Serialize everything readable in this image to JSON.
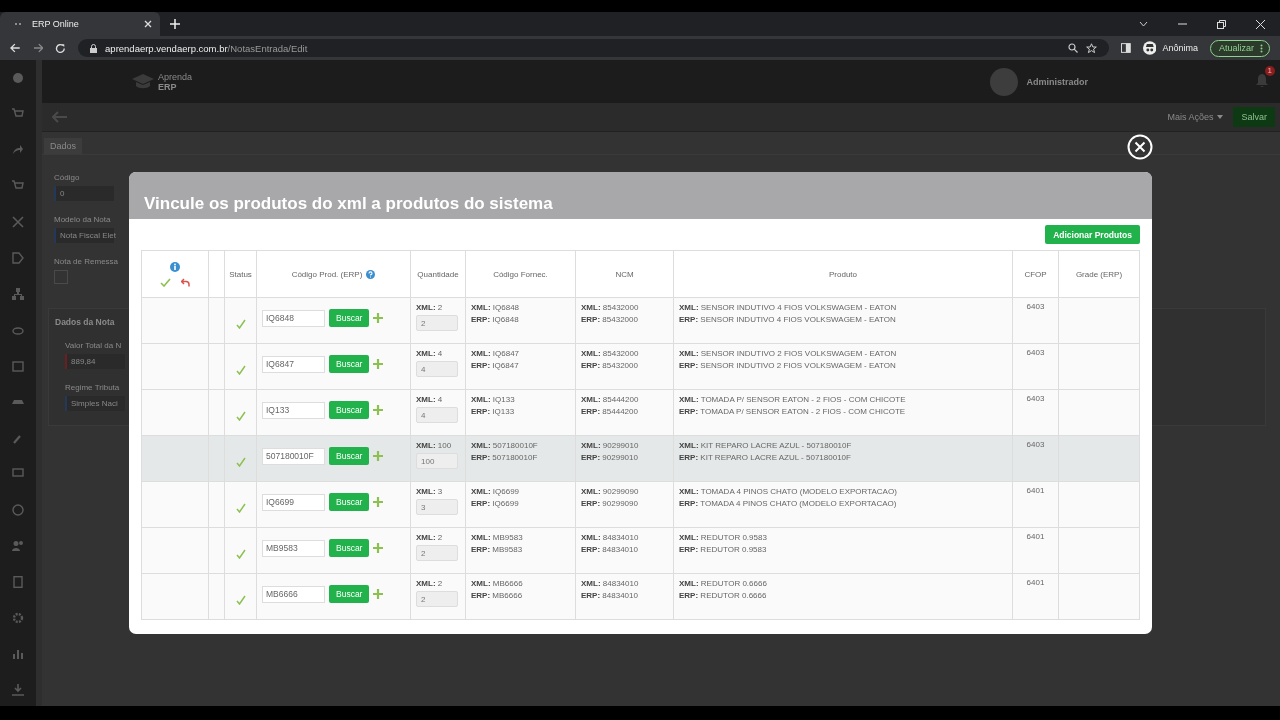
{
  "browser": {
    "tab_title": "ERP Online",
    "url_host": "aprendaerp.vendaerp.com.br",
    "url_path": "/NotasEntrada/Edit",
    "profile": "Anônima",
    "update_button": "Atualizar"
  },
  "app": {
    "logo_top": "Aprenda",
    "logo_bottom": "ERP",
    "user_name": "Administrador",
    "notifications": "1",
    "more_actions": "Mais Ações",
    "save_button": "Salvar",
    "tabs": [
      {
        "label": "Dados",
        "selected": true
      }
    ],
    "fields": [
      {
        "kind": "input",
        "label": "Código",
        "value": "0"
      },
      {
        "kind": "input",
        "label": "Modelo da Nota",
        "value": "Nota Fiscal Elet"
      },
      {
        "kind": "checkbox",
        "label": "Nota de Remessa",
        "checked": false
      }
    ],
    "section": {
      "title": "Dados da Nota",
      "fields": [
        {
          "label": "Valor Total da N",
          "value": "889,84",
          "invalid": true
        },
        {
          "label": "Regime Tributa",
          "value": "Simples Naci",
          "invalid": false
        }
      ]
    }
  },
  "modal": {
    "title": "Vincule os produtos do xml a produtos do sistema",
    "add_button": "Adicionar Produtos",
    "columns": [
      {
        "label": "Status",
        "help": false
      },
      {
        "label": "Código Prod. (ERP)",
        "help": true
      },
      {
        "label": "Quantidade",
        "help": false
      },
      {
        "label": "Código Fornec.",
        "help": false
      },
      {
        "label": "NCM",
        "help": false
      },
      {
        "label": "Produto",
        "help": false
      },
      {
        "label": "CFOP",
        "help": false
      },
      {
        "label": "Grade (ERP)",
        "help": false
      }
    ],
    "rows": [
      {
        "matched": true,
        "highlighted": false,
        "code": "IQ6848",
        "search_label": "Buscar",
        "xml_quantity": "**XML:** 2",
        "quantity": "2",
        "supplier_xml": "**XML:** IQ6848",
        "supplier_erp": "**ERP:** IQ6848",
        "ncm_xml": "**XML:** 85432000",
        "ncm_erp": "**ERP:** 85432000",
        "product_xml": "**XML:** SENSOR INDUTIVO 4 FIOS VOLKSWAGEM - EATON",
        "product_erp": "**ERP:** SENSOR INDUTIVO 4 FIOS VOLKSWAGEM - EATON",
        "cfop": "6403"
      },
      {
        "matched": true,
        "highlighted": false,
        "code": "IQ6847",
        "search_label": "Buscar",
        "xml_quantity": "**XML:** 4",
        "quantity": "4",
        "supplier_xml": "**XML:** IQ6847",
        "supplier_erp": "**ERP:** IQ6847",
        "ncm_xml": "**XML:** 85432000",
        "ncm_erp": "**ERP:** 85432000",
        "product_xml": "**XML:** SENSOR INDUTIVO 2 FIOS VOLKSWAGEM - EATON",
        "product_erp": "**ERP:** SENSOR INDUTIVO 2 FIOS VOLKSWAGEM - EATON",
        "cfop": "6403"
      },
      {
        "matched": true,
        "highlighted": false,
        "code": "IQ133",
        "search_label": "Buscar",
        "xml_quantity": "**XML:** 4",
        "quantity": "4",
        "supplier_xml": "**XML:** IQ133",
        "supplier_erp": "**ERP:** IQ133",
        "ncm_xml": "**XML:** 85444200",
        "ncm_erp": "**ERP:** 85444200",
        "product_xml": "**XML:** TOMADA P/ SENSOR EATON - 2 FIOS - COM CHICOTE",
        "product_erp": "**ERP:** TOMADA P/ SENSOR EATON - 2 FIOS - COM CHICOTE",
        "cfop": "6403"
      },
      {
        "matched": true,
        "highlighted": true,
        "code": "507180010F",
        "search_label": "Buscar",
        "xml_quantity": "**XML:** 100",
        "quantity": "100",
        "supplier_xml": "**XML:** 507180010F",
        "supplier_erp": "**ERP:** 507180010F",
        "ncm_xml": "**XML:** 90299010",
        "ncm_erp": "**ERP:** 90299010",
        "product_xml": "**XML:** KIT REPARO LACRE AZUL - 507180010F",
        "product_erp": "**ERP:** KIT REPARO LACRE AZUL - 507180010F",
        "cfop": "6403"
      },
      {
        "matched": true,
        "highlighted": false,
        "code": "IQ6699",
        "search_label": "Buscar",
        "xml_quantity": "**XML:** 3",
        "quantity": "3",
        "supplier_xml": "**XML:** IQ6699",
        "supplier_erp": "**ERP:** IQ6699",
        "ncm_xml": "**XML:** 90299090",
        "ncm_erp": "**ERP:** 90299090",
        "product_xml": "**XML:** TOMADA 4 PINOS CHATO (MODELO EXPORTACAO)",
        "product_erp": "**ERP:** TOMADA 4 PINOS CHATO (MODELO EXPORTACAO)",
        "cfop": "6401"
      },
      {
        "matched": true,
        "highlighted": false,
        "code": "MB9583",
        "search_label": "Buscar",
        "xml_quantity": "**XML:** 2",
        "quantity": "2",
        "supplier_xml": "**XML:** MB9583",
        "supplier_erp": "**ERP:** MB9583",
        "ncm_xml": "**XML:** 84834010",
        "ncm_erp": "**ERP:** 84834010",
        "product_xml": "**XML:** REDUTOR 0.9583",
        "product_erp": "**ERP:** REDUTOR 0.9583",
        "cfop": "6401"
      },
      {
        "matched": true,
        "highlighted": false,
        "code": "MB6666",
        "search_label": "Buscar",
        "xml_quantity": "**XML:** 2",
        "quantity": "2",
        "supplier_xml": "**XML:** MB6666",
        "supplier_erp": "**ERP:** MB6666",
        "ncm_xml": "**XML:** 84834010",
        "ncm_erp": "**ERP:** 84834010",
        "product_xml": "**XML:** REDUTOR 0.6666",
        "product_erp": "**ERP:** REDUTOR 0.6666",
        "cfop": "6401"
      }
    ]
  }
}
